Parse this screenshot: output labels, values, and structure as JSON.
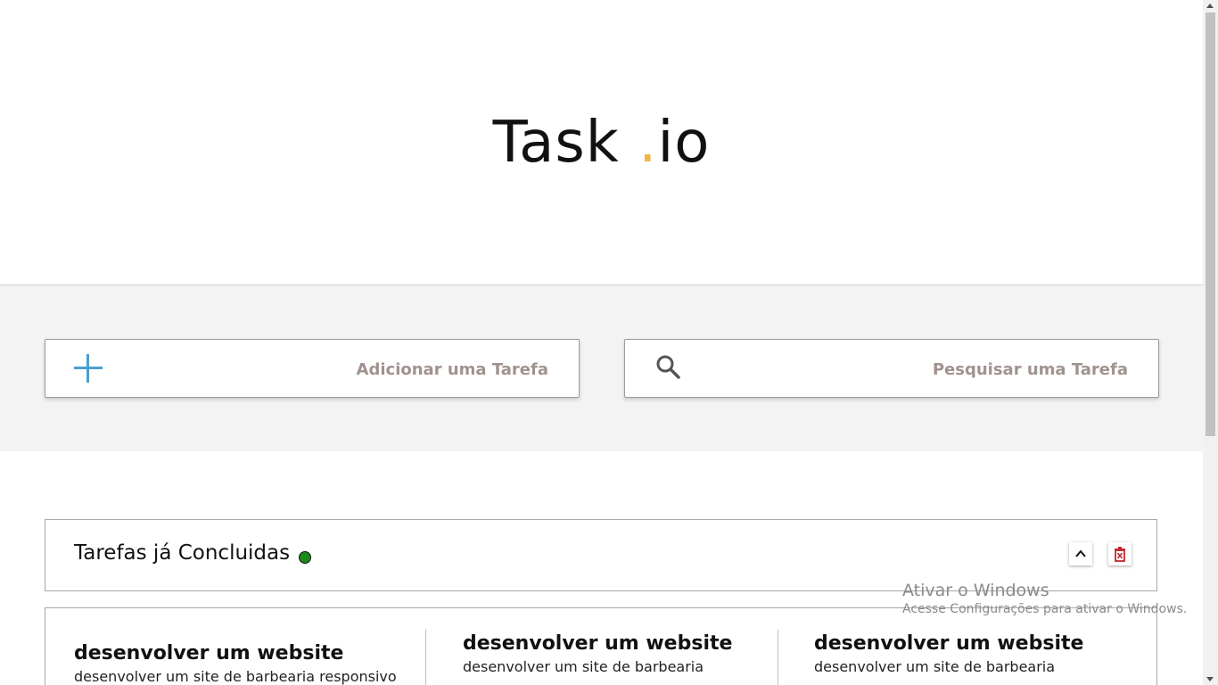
{
  "header": {
    "logo_left": "Task ",
    "logo_dot": ".",
    "logo_right": "io"
  },
  "add_task": {
    "placeholder": "Adicionar uma Tarefa",
    "icon": "plus-icon"
  },
  "search": {
    "placeholder": "Pesquisar uma Tarefa",
    "icon": "search-icon"
  },
  "completed_section": {
    "title": "Tarefas já Concluidas",
    "status_color": "#1b8a1b",
    "collapse_icon": "chevron-up-icon",
    "delete_icon": "trash-icon"
  },
  "tasks": [
    {
      "title": "desenvolver um website",
      "description": "desenvolver um site de barbearia responsivo"
    },
    {
      "title": "desenvolver um website",
      "description": "desenvolver um site de barbearia"
    },
    {
      "title": "desenvolver um website",
      "description": "desenvolver um site de barbearia"
    }
  ],
  "watermark": {
    "line1": "Ativar o Windows",
    "line2": "Acesse Configurações para ativar o Windows."
  },
  "colors": {
    "accent_dot": "#f2b24a",
    "plus_icon": "#4a9fd0",
    "delete_icon": "#c0262b"
  }
}
